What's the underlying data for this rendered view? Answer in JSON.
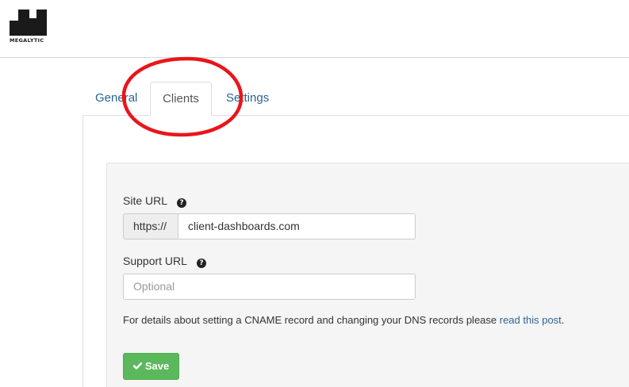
{
  "brand": {
    "logo_text": "MEGALYTIC"
  },
  "tabs": [
    {
      "label": "General"
    },
    {
      "label": "Clients"
    },
    {
      "label": "Settings"
    }
  ],
  "active_tab": "Clients",
  "form": {
    "site_url": {
      "label": "Site URL",
      "prefix": "https://",
      "value": "client-dashboards.com"
    },
    "support_url": {
      "label": "Support URL",
      "placeholder": "Optional"
    },
    "help": {
      "text": "For details about setting a CNAME record and changing your DNS records please ",
      "link_label": "read this post",
      "suffix": "."
    },
    "save_label": "Save"
  },
  "colors": {
    "link": "#2a6496",
    "save_button": "#5cb85c",
    "annotation": "#e8161b"
  },
  "icons": {
    "help": "question-circle-icon",
    "save": "check-icon"
  }
}
